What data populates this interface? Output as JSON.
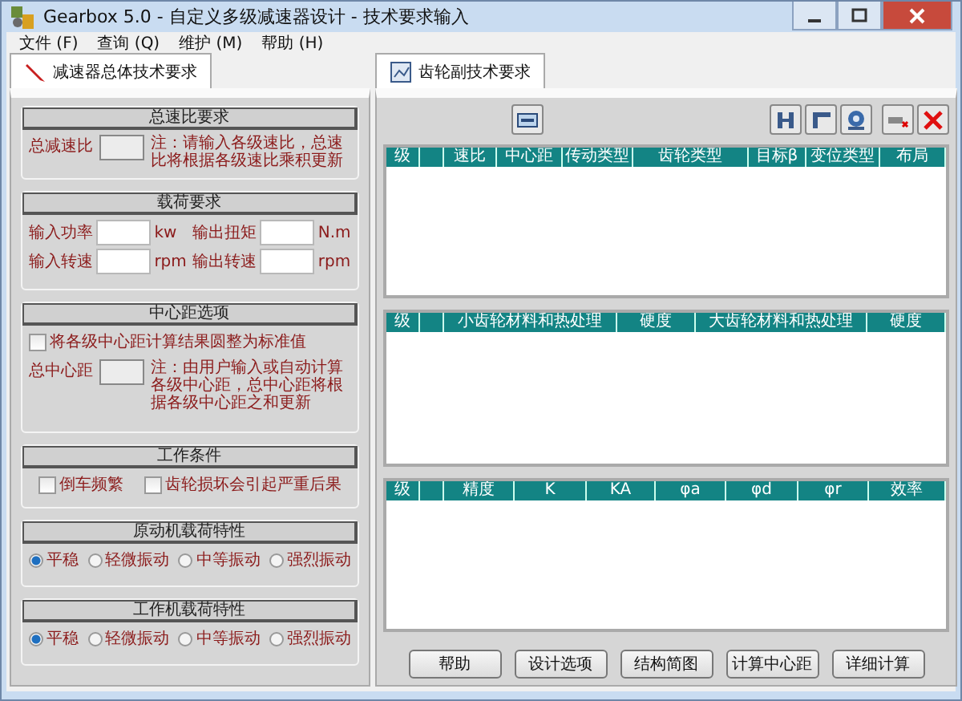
{
  "window": {
    "title": "Gearbox 5.0 - 自定义多级减速器设计 - 技术要求输入"
  },
  "menu": [
    "文件 (F)",
    "查询 (Q)",
    "维护 (M)",
    "帮助 (H)"
  ],
  "left_tab": {
    "label": "减速器总体技术要求",
    "selected": true
  },
  "ratio_section": {
    "title": "总速比要求",
    "label": "总减速比",
    "disabled": true,
    "note": "注：请输入各级速比，总速比将根据各级速比乘积更新"
  },
  "load_section": {
    "title": "载荷要求",
    "fields": [
      {
        "label": "输入功率",
        "unit": "kw"
      },
      {
        "label": "输出扭矩",
        "unit": "N.m"
      },
      {
        "label": "输入转速",
        "unit": "rpm"
      },
      {
        "label": "输出转速",
        "unit": "rpm"
      }
    ]
  },
  "center_section": {
    "title": "中心距选项",
    "checkbox": {
      "label": "将各级中心距计算结果圆整为标准值",
      "checked": false
    },
    "label": "总中心距",
    "disabled": true,
    "note": "注：由用户输入或自动计算各级中心距，总中心距将根据各级中心距之和更新"
  },
  "conditions": {
    "title": "工作条件",
    "checkboxes": [
      {
        "label": "倒车频繁",
        "checked": false
      },
      {
        "label": "齿轮损坏会引起严重后果",
        "checked": false
      }
    ]
  },
  "driver_load": {
    "title": "原动机载荷特性",
    "options": [
      {
        "label": "平稳",
        "selected": true
      },
      {
        "label": "轻微振动",
        "selected": false
      },
      {
        "label": "中等振动",
        "selected": false
      },
      {
        "label": "强烈振动",
        "selected": false
      }
    ]
  },
  "driven_load": {
    "title": "工作机载荷特性",
    "options": [
      {
        "label": "平稳",
        "selected": true
      },
      {
        "label": "轻微振动",
        "selected": false
      },
      {
        "label": "中等振动",
        "selected": false
      },
      {
        "label": "强烈振动",
        "selected": false
      }
    ]
  },
  "right_tab": {
    "label": "齿轮副技术要求",
    "selected": true
  },
  "tables": [
    {
      "columns": [
        "级",
        "速比",
        "中心距",
        "传动类型",
        "齿轮类型",
        "目标β",
        "变位类型",
        "布局"
      ]
    },
    {
      "columns": [
        "级",
        "小齿轮材料和热处理",
        "硬度",
        "大齿轮材料和热处理",
        "硬度"
      ]
    },
    {
      "columns": [
        "级",
        "精度",
        "K",
        "KA",
        "φa",
        "φd",
        "φr",
        "效率"
      ]
    }
  ],
  "buttons": [
    "帮助",
    "设计选项",
    "结构简图",
    "计算中心距",
    "详细计算"
  ]
}
